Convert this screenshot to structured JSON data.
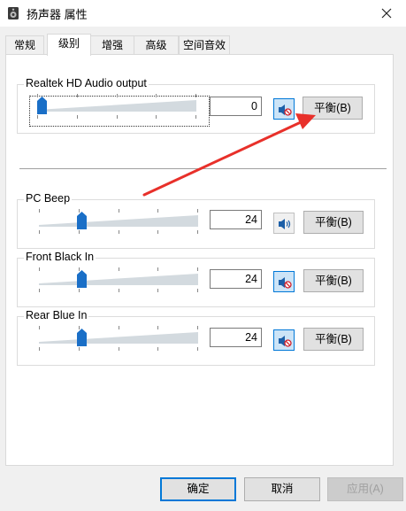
{
  "window": {
    "title": "扬声器 属性"
  },
  "tabs": [
    {
      "label": "常规"
    },
    {
      "label": "级别"
    },
    {
      "label": "增强"
    },
    {
      "label": "高级"
    },
    {
      "label": "空间音效"
    }
  ],
  "active_tab": "级别",
  "devices": [
    {
      "name": "Realtek HD Audio output",
      "value": "0",
      "level": 0.0,
      "muted": true,
      "balance_label": "平衡(B)"
    },
    {
      "name": "PC Beep",
      "value": "24",
      "level": 0.24,
      "muted": false,
      "balance_label": "平衡(B)"
    },
    {
      "name": "Front Black In",
      "value": "24",
      "level": 0.24,
      "muted": true,
      "balance_label": "平衡(B)"
    },
    {
      "name": "Rear Blue In",
      "value": "24",
      "level": 0.24,
      "muted": true,
      "balance_label": "平衡(B)"
    }
  ],
  "footer": {
    "ok_label": "确定",
    "cancel_label": "取消",
    "apply_label": "应用(A)"
  },
  "colors": {
    "accent": "#0078d7",
    "thumb": "#1a6fc7",
    "annotation_arrow": "#e8302a"
  },
  "icons": {
    "speaker": "speaker-icon",
    "mute": "speaker-muted-icon",
    "close": "close-icon",
    "app": "speaker-device-icon"
  }
}
